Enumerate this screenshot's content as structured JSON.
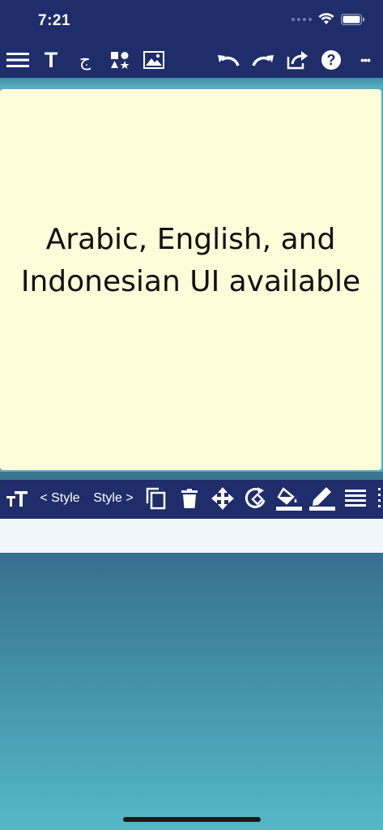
{
  "status_bar": {
    "time": "7:21"
  },
  "top_toolbar": {
    "icons": [
      "menu-icon",
      "text-icon",
      "calligraphy-icon",
      "shapes-icon",
      "image-icon",
      "undo-icon",
      "redo-icon",
      "share-icon",
      "help-icon",
      "more-icon"
    ],
    "text_tool_glyph": "T",
    "calligraphy_glyph": "ج",
    "help_glyph": "?",
    "more_glyph": "•••"
  },
  "canvas": {
    "line1": "Arabic, English, and",
    "line2": "Indonesian UI available",
    "background": "#fefdd9"
  },
  "bottom_toolbar": {
    "prev_style": "< Style",
    "next_style": "Style >",
    "icons": [
      "text-size-icon",
      "duplicate-icon",
      "delete-icon",
      "move-icon",
      "rotate-icon",
      "fill-color-icon",
      "pen-color-icon",
      "align-icon"
    ]
  },
  "colors": {
    "toolbar": "#1f2d6b",
    "teal": "#5aaebf",
    "card": "#fefdd9"
  }
}
